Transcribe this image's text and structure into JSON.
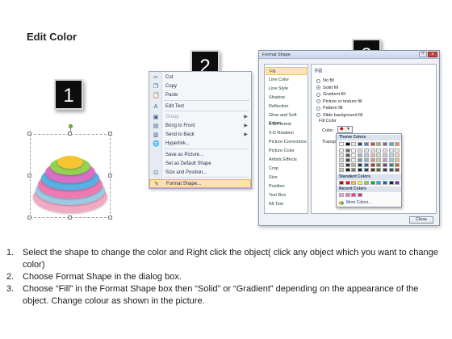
{
  "title": "Edit Color",
  "steps": [
    "1",
    "2",
    "3"
  ],
  "context_menu": {
    "items": [
      {
        "label": "Cut",
        "icon": "scissors-icon",
        "glyph": "✂"
      },
      {
        "label": "Copy",
        "icon": "copy-icon",
        "glyph": "❐"
      },
      {
        "label": "Paste",
        "icon": "paste-icon",
        "glyph": "📋"
      },
      {
        "label": "Edit Text",
        "icon": "edit-text-icon",
        "glyph": "A"
      },
      {
        "label": "Group",
        "icon": "group-icon",
        "glyph": "▣",
        "disabled": true,
        "submenu": true
      },
      {
        "label": "Bring to Front",
        "icon": "bring-front-icon",
        "glyph": "▤",
        "submenu": true
      },
      {
        "label": "Send to Back",
        "icon": "send-back-icon",
        "glyph": "▥",
        "submenu": true
      },
      {
        "label": "Hyperlink...",
        "icon": "hyperlink-icon",
        "glyph": "🌐"
      },
      {
        "label": "Save as Picture...",
        "icon": "",
        "glyph": ""
      },
      {
        "label": "Set as Default Shape",
        "icon": "",
        "glyph": ""
      },
      {
        "label": "Size and Position...",
        "icon": "size-position-icon",
        "glyph": "⊡"
      },
      {
        "label": "Format Shape...",
        "icon": "format-shape-icon",
        "glyph": "✎",
        "highlight": true
      }
    ]
  },
  "dialog": {
    "title": "Format Shape",
    "help": "?",
    "close_x": "x",
    "nav_items": [
      "Fill",
      "Line Color",
      "Line Style",
      "Shadow",
      "Reflection",
      "Glow and Soft Edges",
      "3-D Format",
      "3-D Rotation",
      "Picture Corrections",
      "Picture Color",
      "Artistic Effects",
      "Crop",
      "Size",
      "Position",
      "Text Box",
      "Alt Text"
    ],
    "selected_nav": "Fill",
    "section_title": "Fill",
    "fill_options": [
      {
        "label": "No fill",
        "checked": false
      },
      {
        "label": "Solid fill",
        "checked": true
      },
      {
        "label": "Gradient fill",
        "checked": false
      },
      {
        "label": "Picture or texture fill",
        "checked": false
      },
      {
        "label": "Pattern fill",
        "checked": false
      },
      {
        "label": "Slide background fill",
        "checked": false
      }
    ],
    "fill_color_heading": "Fill Color",
    "color_label": "Color:",
    "transparency_label": "Transpa",
    "close_button": "Close"
  },
  "palette": {
    "theme_heading": "Theme Colors",
    "standard_heading": "Standard Colors",
    "recent_heading": "Recent Colors",
    "more_colors": "More Colors...",
    "theme_top": [
      "#ffffff",
      "#000000",
      "#eeece1",
      "#1f497d",
      "#4f81bd",
      "#c0504d",
      "#9bbb59",
      "#8064a2",
      "#4bacc6",
      "#f79646"
    ],
    "standard": [
      "#c00000",
      "#ff0000",
      "#ffc000",
      "#ffff00",
      "#92d050",
      "#00b050",
      "#00b0f0",
      "#0070c0",
      "#002060",
      "#7030a0"
    ],
    "recent": [
      "#ff99cc",
      "#ff66cc",
      "#ff3399",
      "#cc3399"
    ]
  },
  "shape_layers": [
    "#f2a9c4",
    "#9ccbe6",
    "#ed7bb1",
    "#5ab0e0",
    "#d86fc5",
    "#93d150",
    "#f5c430"
  ],
  "instructions": [
    {
      "num": "1.",
      "text": "Select the shape to change the color and Right click the object( click any object which you want to change color)"
    },
    {
      "num": "2.",
      "text": "Choose Format Shape in the dialog box."
    },
    {
      "num": "3.",
      "text": "Choose “Fill” in the Format Shape box then “Solid” or “Gradient” depending on the appearance of the object. Change colour as shown in the picture."
    }
  ]
}
